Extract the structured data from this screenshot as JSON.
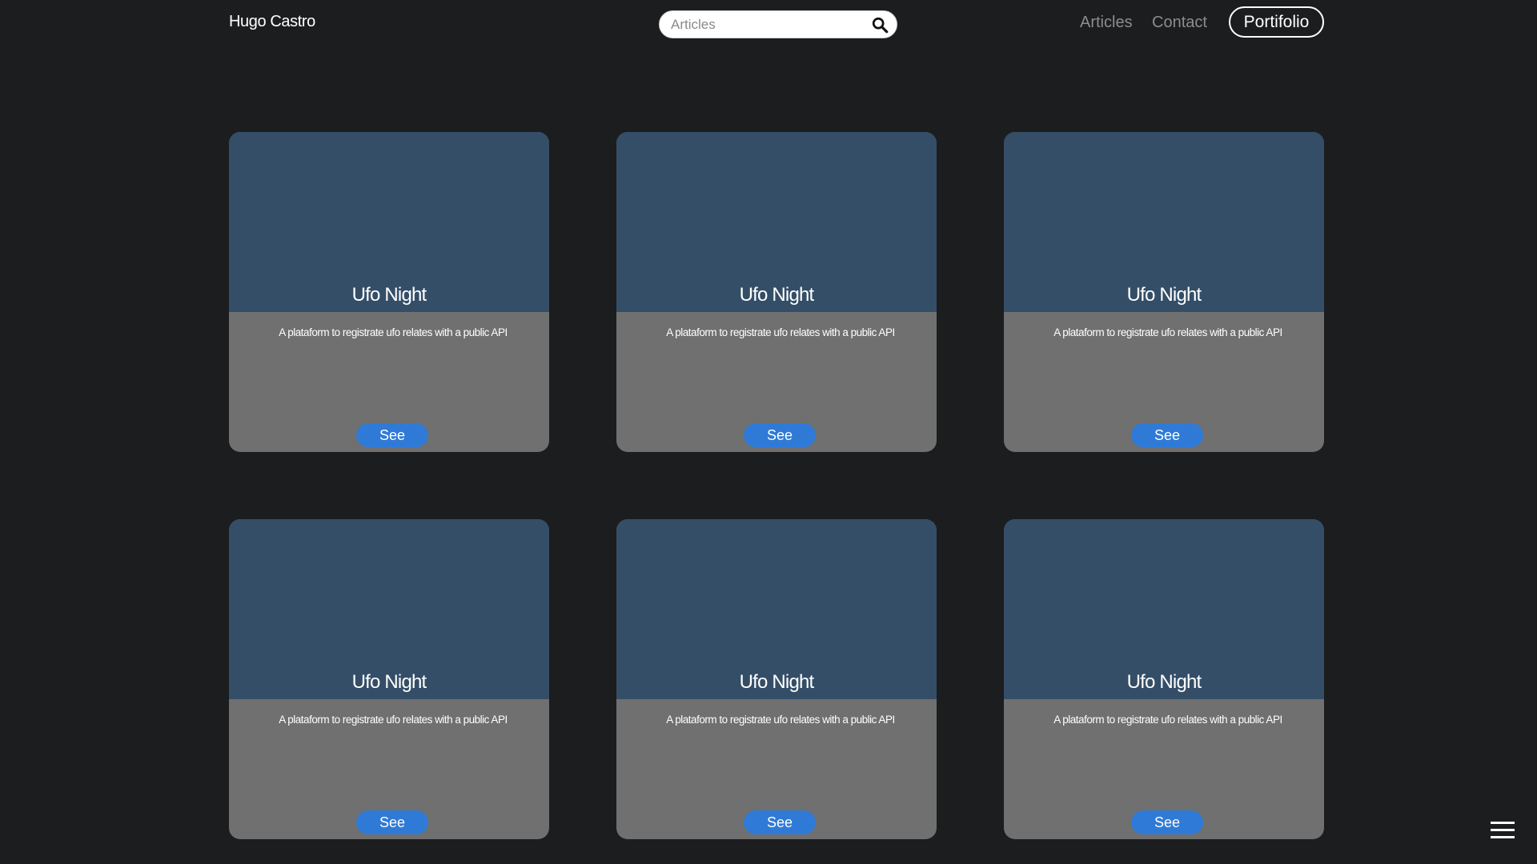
{
  "header": {
    "brand": "Hugo Castro",
    "search_placeholder": "Articles",
    "nav": {
      "articles": "Articles",
      "contact": "Contact",
      "portfolio": "Portifolio"
    }
  },
  "cards": [
    {
      "title": "Ufo Night",
      "description": "A plataform to registrate ufo relates with a public API",
      "button": "See"
    },
    {
      "title": "Ufo Night",
      "description": "A plataform to registrate ufo relates with a public API",
      "button": "See"
    },
    {
      "title": "Ufo Night",
      "description": "A plataform to registrate ufo relates with a public API",
      "button": "See"
    },
    {
      "title": "Ufo Night",
      "description": "A plataform to registrate ufo relates with a public API",
      "button": "See"
    },
    {
      "title": "Ufo Night",
      "description": "A plataform to registrate ufo relates with a public API",
      "button": "See"
    },
    {
      "title": "Ufo Night",
      "description": "A plataform to registrate ufo relates with a public API",
      "button": "See"
    }
  ],
  "colors": {
    "background": "#1c1d1f",
    "card_top": "#344e68",
    "card_bottom": "#707070",
    "button": "#2f7ad6"
  },
  "icons": {
    "search": "search-icon",
    "menu": "hamburger-menu-icon"
  }
}
